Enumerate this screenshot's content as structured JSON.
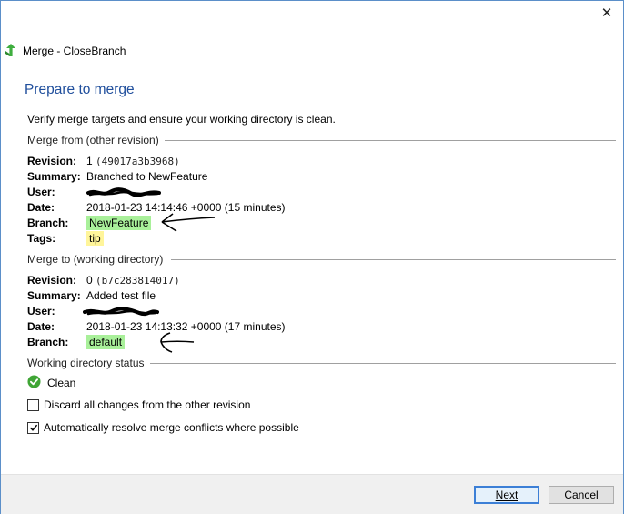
{
  "window": {
    "title": "Merge - CloseBranch",
    "close_glyph": "✕",
    "title_icon": "merge-arrow-icon"
  },
  "heading": "Prepare to merge",
  "intro": "Verify merge targets and ensure your working directory is clean.",
  "merge_from": {
    "header": "Merge from (other revision)",
    "labels": {
      "revision": "Revision:",
      "summary": "Summary:",
      "user": "User:",
      "date": "Date:",
      "branch": "Branch:",
      "tags": "Tags:"
    },
    "revision_num": "1",
    "revision_hash": "(49017a3b3968)",
    "summary": "Branched to NewFeature",
    "date": "2018-01-23 14:14:46 +0000 (15 minutes)",
    "branch": "NewFeature",
    "tags": "tip"
  },
  "merge_to": {
    "header": "Merge to (working directory)",
    "labels": {
      "revision": "Revision:",
      "summary": "Summary:",
      "user": "User:",
      "date": "Date:",
      "branch": "Branch:"
    },
    "revision_num": "0",
    "revision_hash": "(b7c283814017)",
    "summary": "Added test file",
    "date": "2018-01-23 14:13:32 +0000 (17 minutes)",
    "branch": "default"
  },
  "working_status": {
    "header": "Working directory status",
    "status": "Clean",
    "status_icon": "check-circle-icon"
  },
  "options": {
    "discard_label": "Discard all changes from the other revision",
    "discard_checked": false,
    "autoresolve_label": "Automatically resolve merge conflicts where possible",
    "autoresolve_checked": true
  },
  "buttons": {
    "next_label": "Next",
    "cancel_label": "Cancel"
  },
  "colors": {
    "heading": "#1f4e9c",
    "branch_highlight": "#a9f09a",
    "tag_highlight": "#fff59a",
    "primary_border": "#3c7fd6",
    "check_green": "#3fa535"
  }
}
